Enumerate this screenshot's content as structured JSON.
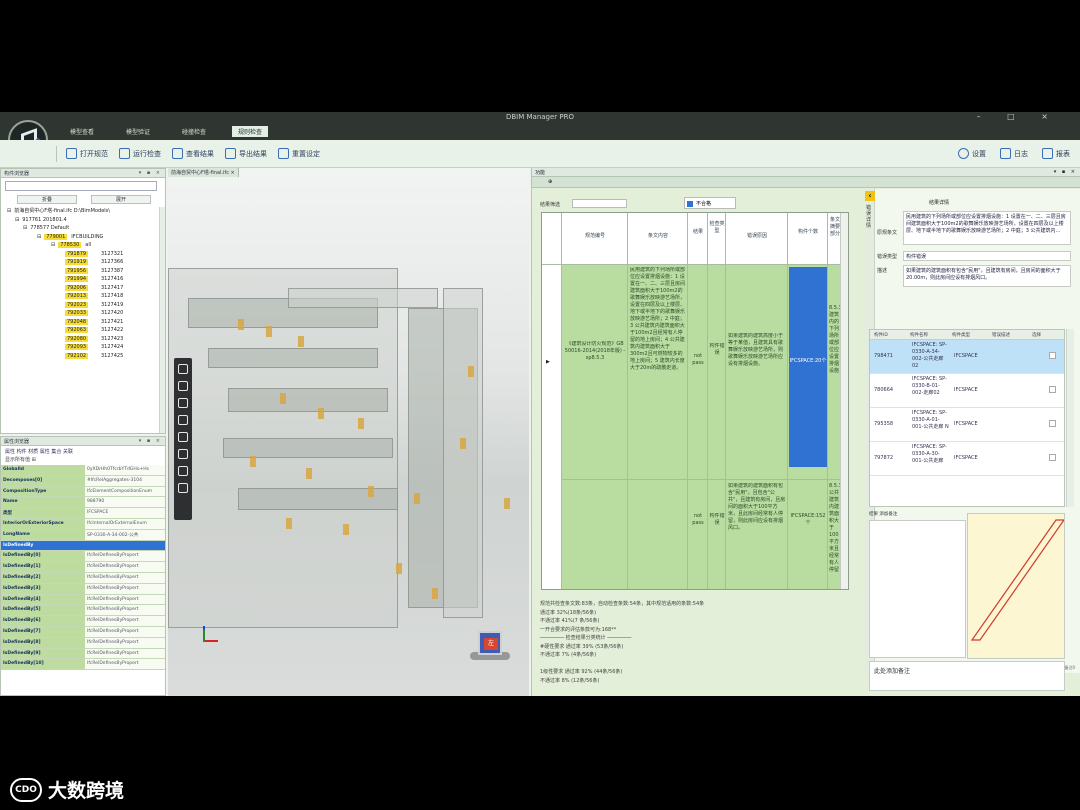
{
  "window": {
    "title": "DBIM Manager PRO",
    "controls": "– □ ×"
  },
  "menu": {
    "tabs": [
      "模型查看",
      "模型验证",
      "碰撞检查",
      "规则检查"
    ],
    "active_index": 3
  },
  "toolbar": {
    "left": [
      "打开规范",
      "运行检查",
      "查看结果",
      "导出结果",
      "重置设定"
    ],
    "right": [
      "设置",
      "日志",
      "报表"
    ]
  },
  "tree_panel": {
    "title": "构件浏览器",
    "pins": "▾ ▪ ×",
    "buttons": [
      "折叠",
      "展开"
    ],
    "rows": [
      {
        "indent": 6,
        "prefix": "⊟",
        "label": "前海自贸中心F塔-final.ifc D:\\BimModels\\",
        "hl": false,
        "id": ""
      },
      {
        "indent": 14,
        "prefix": "⊟",
        "label": "917761 201801.4",
        "hl": false,
        "id": ""
      },
      {
        "indent": 22,
        "prefix": "⊟",
        "label": "778577 Default",
        "hl": false,
        "id": ""
      },
      {
        "indent": 36,
        "prefix": "⊟",
        "label": "779001",
        "hl": true,
        "tail": "IFCBUILDING",
        "id": ""
      },
      {
        "indent": 50,
        "prefix": "⊟",
        "label": "778530",
        "hl": true,
        "tail": "all",
        "id": ""
      },
      {
        "indent": 64,
        "prefix": "",
        "label": "791879",
        "hl": true,
        "id": "3127321"
      },
      {
        "indent": 64,
        "prefix": "",
        "label": "791919",
        "hl": true,
        "id": "3127366"
      },
      {
        "indent": 64,
        "prefix": "",
        "label": "791956",
        "hl": true,
        "id": "3127387"
      },
      {
        "indent": 64,
        "prefix": "",
        "label": "791994",
        "hl": true,
        "id": "3127416"
      },
      {
        "indent": 64,
        "prefix": "",
        "label": "792006",
        "hl": true,
        "id": "3127417"
      },
      {
        "indent": 64,
        "prefix": "",
        "label": "792013",
        "hl": true,
        "id": "3127418"
      },
      {
        "indent": 64,
        "prefix": "",
        "label": "792023",
        "hl": true,
        "id": "3127419"
      },
      {
        "indent": 64,
        "prefix": "",
        "label": "792033",
        "hl": true,
        "id": "3127420"
      },
      {
        "indent": 64,
        "prefix": "",
        "label": "792048",
        "hl": true,
        "id": "3127421"
      },
      {
        "indent": 64,
        "prefix": "",
        "label": "792063",
        "hl": true,
        "id": "3127422"
      },
      {
        "indent": 64,
        "prefix": "",
        "label": "792080",
        "hl": true,
        "id": "3127423"
      },
      {
        "indent": 64,
        "prefix": "",
        "label": "792093",
        "hl": true,
        "id": "3127424"
      },
      {
        "indent": 64,
        "prefix": "",
        "label": "792102",
        "hl": true,
        "id": "3127425"
      }
    ]
  },
  "prop_panel": {
    "title": "属性浏览器",
    "tabs": "属性 构件 材质 属性 集合 关联",
    "tools": "显示所有值   ⊞",
    "rows": [
      {
        "k": "GlobalId",
        "v": "0yXDrHh0TfcrbYTdGHo+Hs",
        "sel": false
      },
      {
        "k": "Decomposes[0]",
        "v": "#IfcRelAggregates-3104",
        "sel": false
      },
      {
        "k": "CompositionType",
        "v": "IfcElementCompositionEnum",
        "sel": false
      },
      {
        "k": "Name",
        "v": "988790",
        "sel": false
      },
      {
        "k": "类型",
        "v": "IFCSPACE",
        "sel": false
      },
      {
        "k": "InteriorOrExteriorSpace",
        "v": "IfcInternalOrExternalEnum",
        "sel": false
      },
      {
        "k": "LongName",
        "v": "SP-0330-A-34-002-公共",
        "sel": false
      },
      {
        "k": "IsDefinedBy",
        "v": "",
        "sel": true
      },
      {
        "k": "IsDefinedBy[0]",
        "v": "IfcRelDefinesByPropert",
        "sel": false
      },
      {
        "k": "IsDefinedBy[1]",
        "v": "IfcRelDefinesByPropert",
        "sel": false
      },
      {
        "k": "IsDefinedBy[2]",
        "v": "IfcRelDefinesByPropert",
        "sel": false
      },
      {
        "k": "IsDefinedBy[3]",
        "v": "IfcRelDefinesByPropert",
        "sel": false
      },
      {
        "k": "IsDefinedBy[4]",
        "v": "IfcRelDefinesByPropert",
        "sel": false
      },
      {
        "k": "IsDefinedBy[5]",
        "v": "IfcRelDefinesByPropert",
        "sel": false
      },
      {
        "k": "IsDefinedBy[6]",
        "v": "IfcRelDefinesByPropert",
        "sel": false
      },
      {
        "k": "IsDefinedBy[7]",
        "v": "IfcRelDefinesByPropert",
        "sel": false
      },
      {
        "k": "IsDefinedBy[8]",
        "v": "IfcRelDefinesByPropert",
        "sel": false
      },
      {
        "k": "IsDefinedBy[9]",
        "v": "IfcRelDefinesByPropert",
        "sel": false
      },
      {
        "k": "IsDefinedBy[10]",
        "v": "IfcRelDefinesByPropert",
        "sel": false
      }
    ]
  },
  "viewport": {
    "tab": "前海自贸中心F塔-final.ifc ×",
    "cube_label": "左"
  },
  "checker": {
    "title": "功能",
    "pins": "▾ ▪ ×",
    "bar": "⊕",
    "filter_label": "结果筛选",
    "filter_check": "不合格",
    "headers": [
      "规范编号",
      "条文内容",
      "结果",
      "检查类型",
      "错误原因",
      "构件个数",
      "条文摘要部分"
    ],
    "row1": {
      "code": "《建筑设计防火规范》GB 50016-2014(2018年版) -sp8.5.3",
      "content": "民用建筑的下列场所或部位应设置排烟设施：1 设置在一、二、三层且房间建筑面积大于100m2的歌舞娱乐放映游艺场所，设置在四层及以上楼层、地下或半地下的歌舞娱乐放映游艺场所；2 中庭；3 公共建筑内建筑面积大于100m2且经常有人停留的地上房间；4 公共建筑内建筑面积大于300m2且可燃物较多的地上房间；5 建筑内长度大于20m的疏散走道。",
      "result": "not pass",
      "type": "构件错误",
      "reason": "如果建筑的建筑高度小于等于某值，且建筑具有歌舞娱乐放映游艺场所，则歌舞娱乐放映游艺场所应设有排烟设施。",
      "count": "IFCSPACE:20个",
      "clause": "8.5.3 建筑内的下列场所或部位应设置排烟设施"
    },
    "row2": {
      "result": "not pass",
      "type": "构件错误",
      "reason": "如果建筑的建筑面积有包含\"民用\"，且包含\"公共\"，且建筑有房间，且房间的面积大于100平方米，且此房间经常有人停留，则此房间应设有排烟风口。",
      "count": "IFCSPACE:152个",
      "clause": "8.5.3 公共建筑内建筑面积大于100平方米且经常有人停留"
    },
    "summary": [
      "规范共检查条文数:83条，自动检查条数:54条，其中规范适用的条数:54条",
      "通过率 32%(18条/56条)",
      "不通过率 41%(7 条/56条)",
      "一开合要求的评估条款可为:168**",
      "──────── 检查结果分类统计 ────────",
      "#硬性要求   通过率 39% (53条/56条)",
      "不通过率 7% (4条/56条)",
      "",
      "1级性要求   通过率 92% (44条/56条)",
      "不通过率 8% (12条/56条)"
    ]
  },
  "detail": {
    "side_text": "错误详情",
    "title": "结果详情",
    "labels": [
      "原规条文",
      "错误类型",
      "描述"
    ],
    "original": "民用建筑的下列场所或部位应设置排烟设施：1 设置在一、二、三层且房间建筑面积大于100m2的歌舞娱乐放映游艺场所，设置在四层及以上楼层、地下或半地下的歌舞娱乐放映游艺场所；2 中庭；3 公共建筑内…",
    "error_type": "构件错误",
    "description": "如果建筑的建筑面积有包含\"民用\"，且建筑有房间，且房间的面积大于20.00m，则此房间应设有排烟风口。",
    "comp_headers": [
      "构件ID",
      "构件名称",
      "构件类型",
      "错误描述",
      "选择"
    ],
    "comps": [
      {
        "id": "798471",
        "name": "IFCSPACE: SP-0330-A-34-002-公共走廊 02",
        "type": "IFCSPACE",
        "sel": true
      },
      {
        "id": "780664",
        "name": "IFCSPACE: SP-0330-B-01-002-走廊02",
        "type": "IFCSPACE",
        "sel": false
      },
      {
        "id": "795358",
        "name": "IFCSPACE: SP-0330-A-01-001-公共走廊 N",
        "type": "IFCSPACE",
        "sel": false
      },
      {
        "id": "797872",
        "name": "IFCSPACE: SP-0330-A-30-001-公共走廊",
        "type": "IFCSPACE",
        "sel": false
      }
    ],
    "mini_tabs": "结果   添加备注",
    "note_placeholder": "此处添加备注",
    "corner": "备注0"
  },
  "brand": {
    "mark": "CDO",
    "text": "大数跨境"
  }
}
